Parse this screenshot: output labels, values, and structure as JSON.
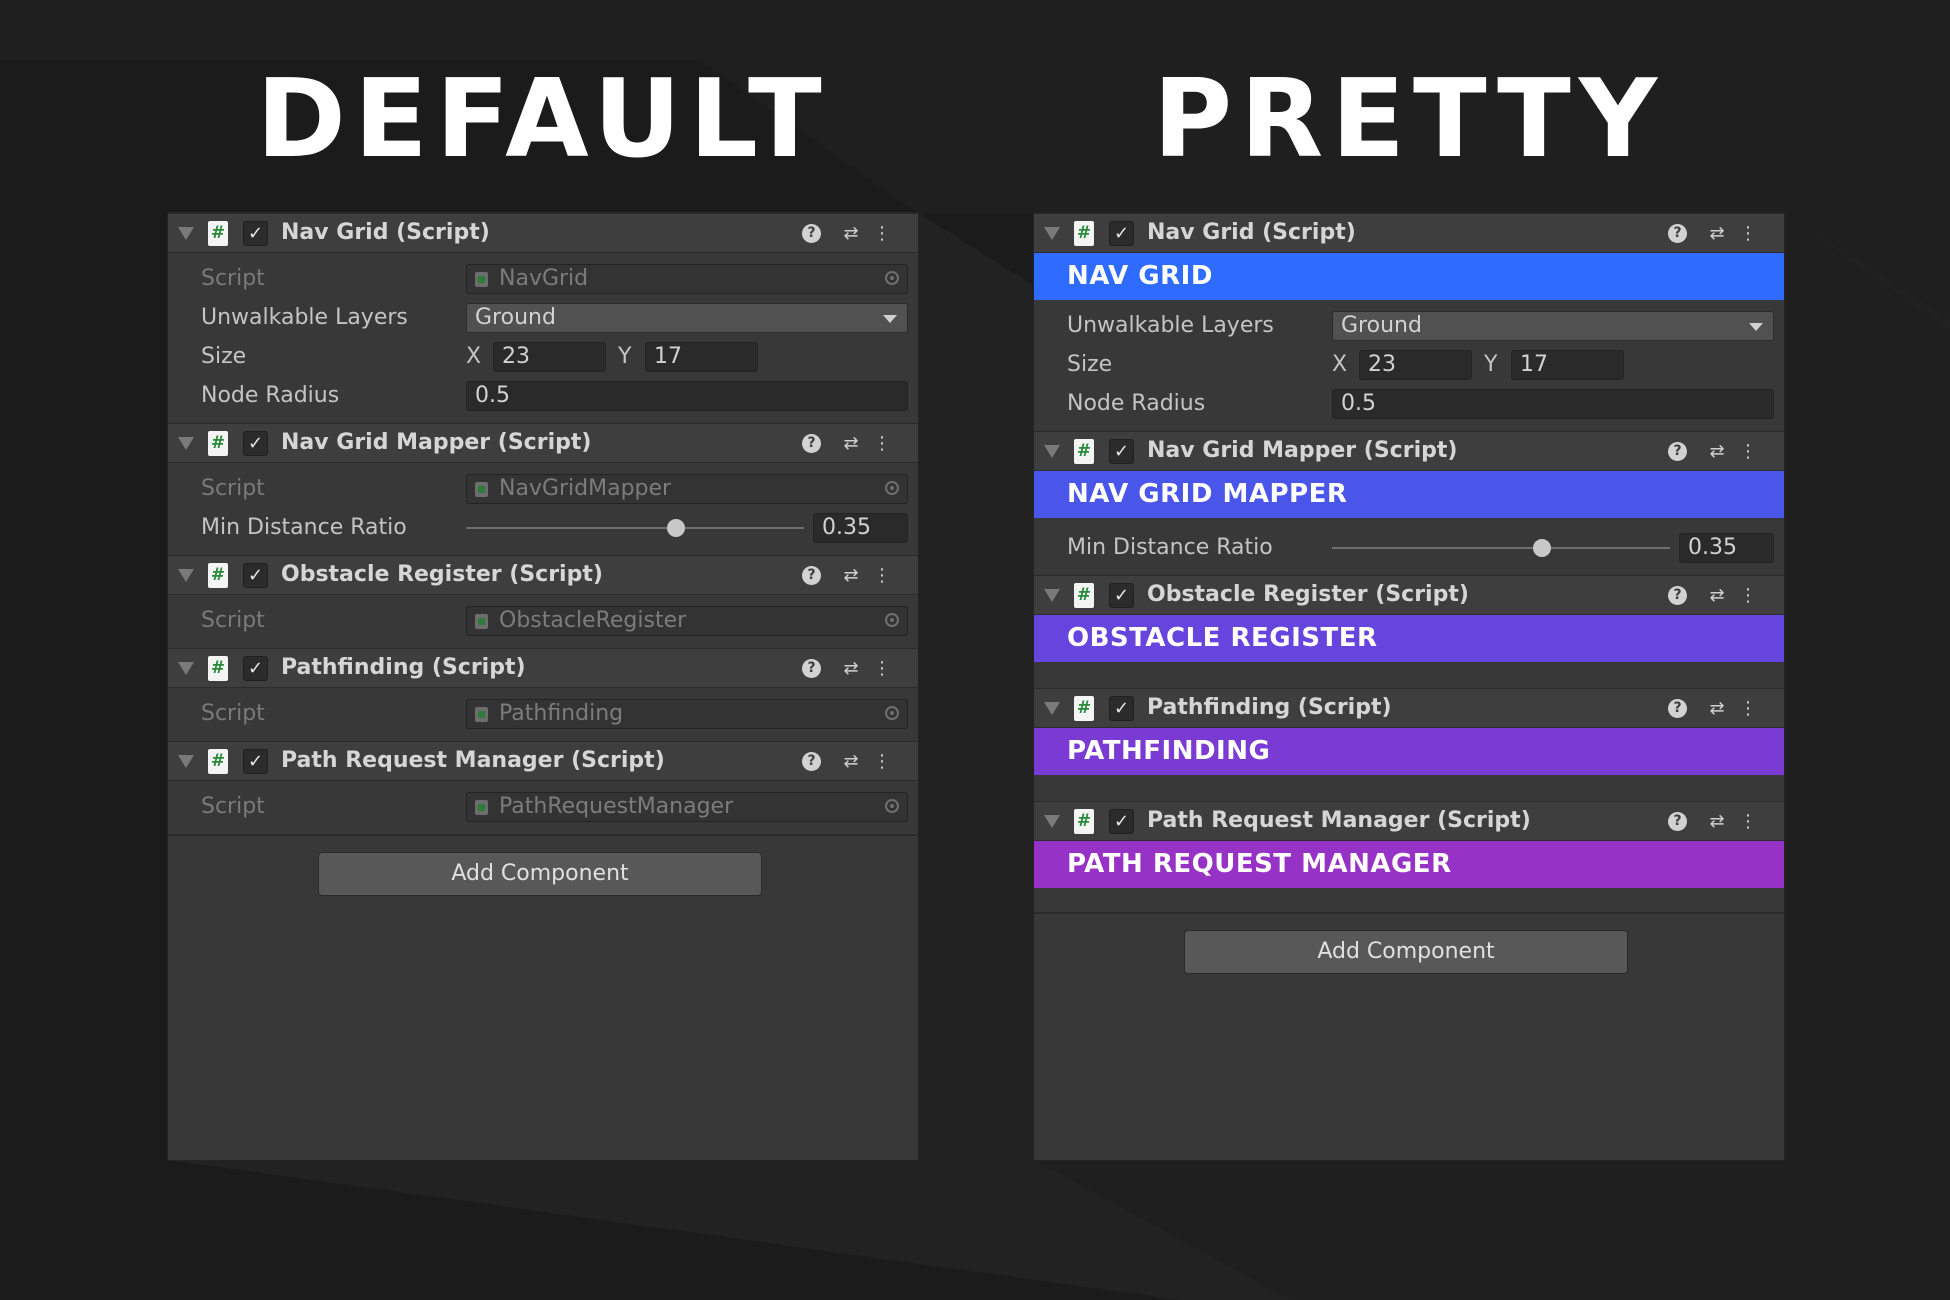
{
  "headings": {
    "left": "DEFAULT",
    "right": "PRETTY"
  },
  "icons": {
    "fold": "triangle-down-icon",
    "script": "csharp-script-icon",
    "help": "help-icon",
    "presets": "presets-sliders-icon",
    "menu": "kebab-menu-icon",
    "target": "object-picker-icon",
    "dropdown": "chevron-down-icon"
  },
  "glyphs": {
    "hash": "#",
    "check": "✓",
    "help": "?",
    "presets": "⇄",
    "menu": "⋮"
  },
  "inspector": {
    "components": [
      {
        "title": "Nav Grid (Script)",
        "banner": "NAV GRID",
        "banner_color": "#2f6bff",
        "script_label": "Script",
        "script_value": "NavGrid",
        "layers_label": "Unwalkable Layers",
        "layers_value": "Ground",
        "size_label": "Size",
        "size_x_label": "X",
        "size_x": "23",
        "size_y_label": "Y",
        "size_y": "17",
        "radius_label": "Node Radius",
        "radius_value": "0.5"
      },
      {
        "title": "Nav Grid Mapper (Script)",
        "banner": "NAV GRID MAPPER",
        "banner_color": "#4a55ea",
        "script_label": "Script",
        "script_value": "NavGridMapper",
        "ratio_label": "Min Distance Ratio",
        "ratio_value": "0.35",
        "ratio_fraction": 0.62
      },
      {
        "title": "Obstacle Register (Script)",
        "banner": "OBSTACLE REGISTER",
        "banner_color": "#6644de",
        "script_label": "Script",
        "script_value": "ObstacleRegister"
      },
      {
        "title": "Pathfinding (Script)",
        "banner": "PATHFINDING",
        "banner_color": "#7a3bd4",
        "script_label": "Script",
        "script_value": "Pathfinding"
      },
      {
        "title": "Path Request Manager (Script)",
        "banner": "PATH REQUEST MANAGER",
        "banner_color": "#9632c6",
        "script_label": "Script",
        "script_value": "PathRequestManager"
      }
    ],
    "add_component": "Add Component"
  }
}
